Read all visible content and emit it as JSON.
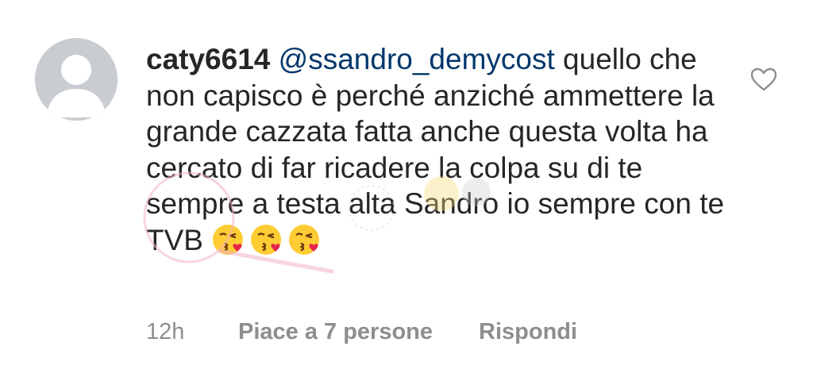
{
  "comment": {
    "username": "caty6614",
    "mention": "@ssandro_demycost",
    "body": " quello che non capisco è perché anziché ammettere la grande cazzata fatta anche questa volta ha cercato di far ricadere la colpa su di te sempre a testa alta Sandro io sempre con te TVB ",
    "emojis": [
      "kissing-heart-emoji",
      "kissing-heart-emoji",
      "kissing-heart-emoji"
    ],
    "timestamp": "12h",
    "likes_label": "Piace a 7 persone",
    "reply_label": "Rispondi",
    "like_icon": "heart-outline-icon",
    "avatar_icon": "default-avatar-icon"
  },
  "colors": {
    "text": "#262626",
    "mention": "#00376b",
    "meta": "#8e8e8e",
    "avatar_bg": "#c9cdd2"
  }
}
